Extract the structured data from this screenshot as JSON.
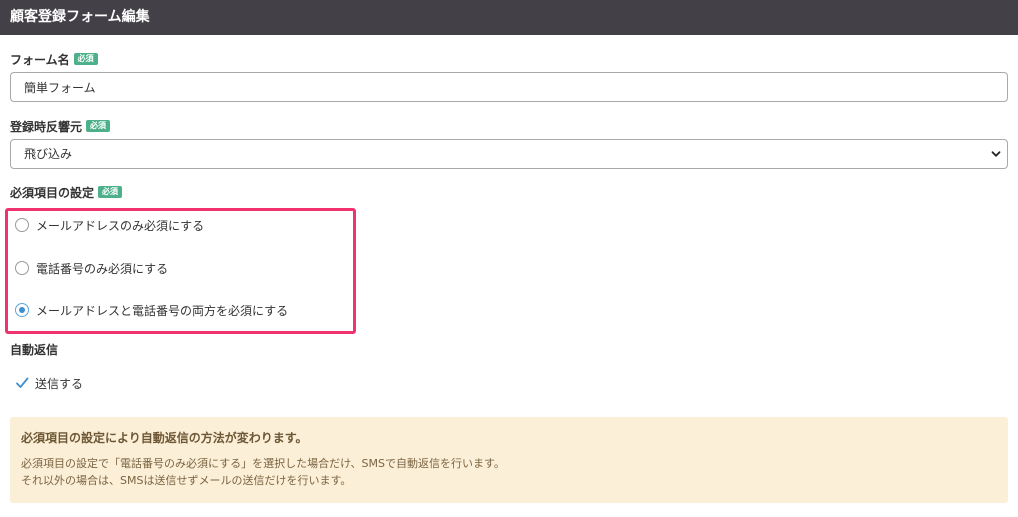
{
  "header": {
    "title": "顧客登録フォーム編集"
  },
  "form_name": {
    "label": "フォーム名",
    "badge": "必須",
    "value": "簡単フォーム"
  },
  "source": {
    "label": "登録時反響元",
    "badge": "必須",
    "selected": "飛び込み"
  },
  "required_settings": {
    "label": "必須項目の設定",
    "badge": "必須",
    "options": [
      {
        "label": "メールアドレスのみ必須にする",
        "checked": false
      },
      {
        "label": "電話番号のみ必須にする",
        "checked": false
      },
      {
        "label": "メールアドレスと電話番号の両方を必須にする",
        "checked": true
      }
    ]
  },
  "auto_reply": {
    "label": "自動返信",
    "checkbox_label": "送信する",
    "checked": true
  },
  "notice": {
    "title": "必須項目の設定により自動返信の方法が変わります。",
    "line1": "必須項目の設定で「電話番号のみ必須にする」を選択した場合だけ、SMSで自動返信を行います。",
    "line2": "それ以外の場合は、SMSは送信せずメールの送信だけを行います。"
  },
  "colors": {
    "header_bg": "#434048",
    "badge": "#4cb08a",
    "highlight": "#f0336f",
    "notice_bg": "#fcefd8",
    "radio_checked": "#3d8fd0"
  }
}
